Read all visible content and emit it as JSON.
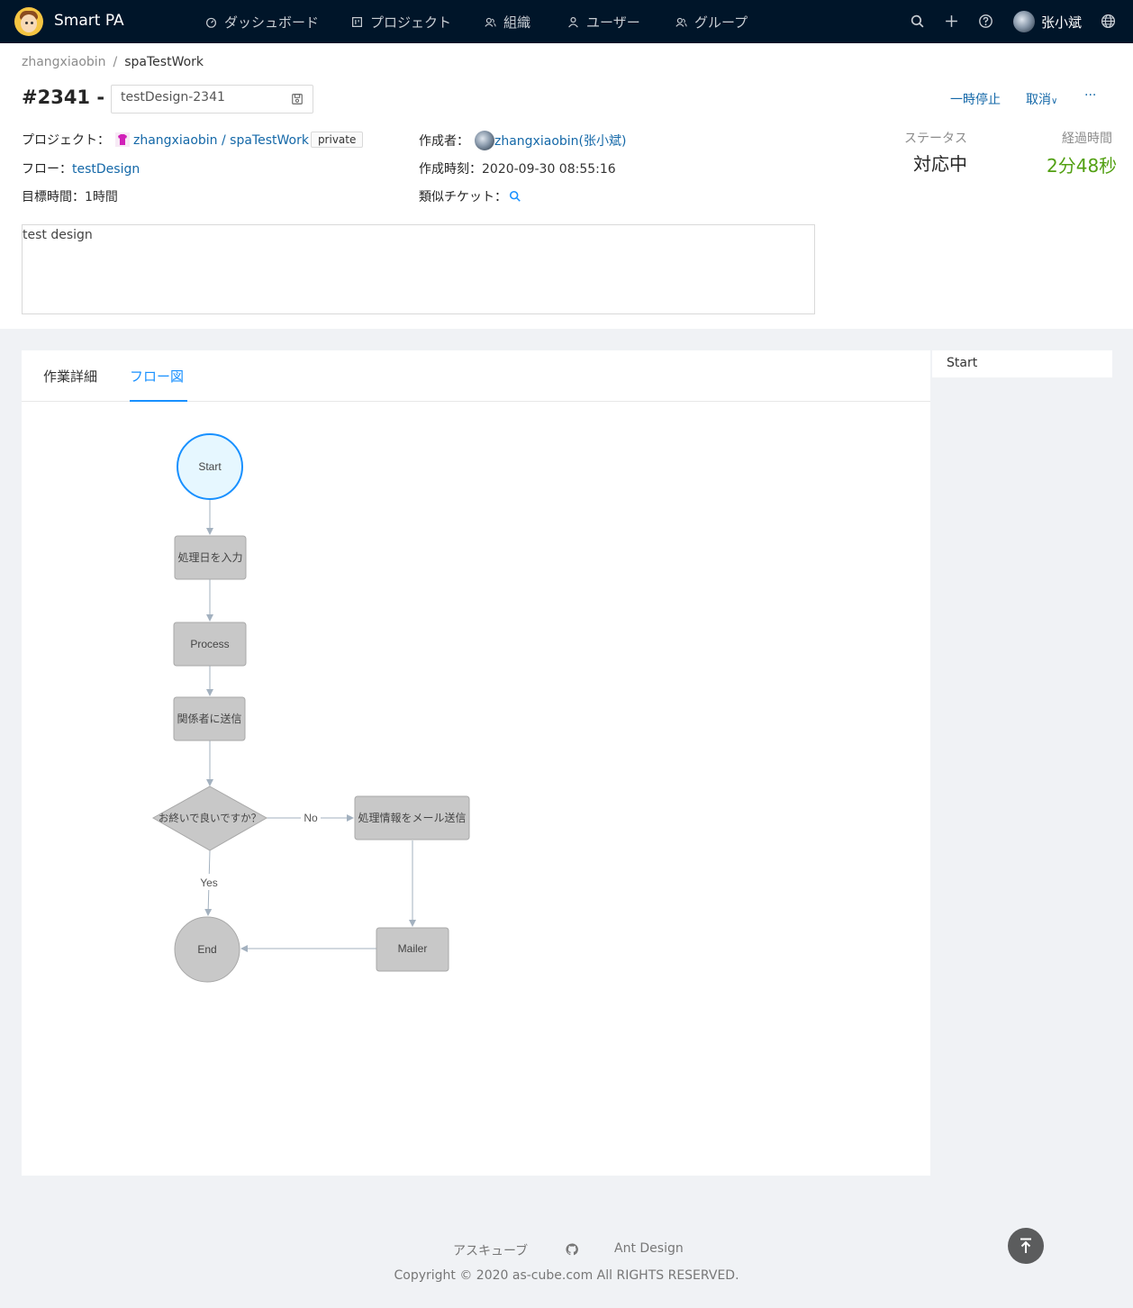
{
  "header": {
    "brand": "Smart PA",
    "nav": [
      {
        "label": "ダッシュボード",
        "icon": "dashboard-icon"
      },
      {
        "label": "プロジェクト",
        "icon": "project-icon"
      },
      {
        "label": "組織",
        "icon": "team-icon"
      },
      {
        "label": "ユーザー",
        "icon": "user-icon"
      },
      {
        "label": "グループ",
        "icon": "team-icon"
      }
    ],
    "user_name": "张小斌",
    "icons": [
      "search-icon",
      "plus-icon",
      "question-icon",
      "global-icon"
    ]
  },
  "breadcrumb": {
    "owner": "zhangxiaobin",
    "separator": "/",
    "project": "spaTestWork"
  },
  "ticket": {
    "number": "#2341 -",
    "title_value": "testDesign-2341",
    "actions": {
      "pause": "一時停止",
      "cancel": "取消",
      "cancel_chevron": "∨",
      "more": "···"
    }
  },
  "fields": {
    "project_label": "プロジェクト：",
    "project_value": "zhangxiaobin / spaTestWork",
    "project_visibility": "private",
    "flow_label": "フロー：",
    "flow_value": "testDesign",
    "target_label": "目標時間：",
    "target_value": "1時間",
    "author_label": "作成者：",
    "author_value": "zhangxiaobin(张小斌)",
    "created_label": "作成時刻：",
    "created_value": "2020-09-30 08:55:16",
    "similar_label": "類似チケット："
  },
  "status": {
    "status_label": "ステータス",
    "status_value": "対応中",
    "elapsed_label": "経過時間",
    "elapsed_value": "2分48秒",
    "elapsed_color": "#52a012"
  },
  "description": "test design",
  "tabs": [
    {
      "label": "作業詳細",
      "active": false
    },
    {
      "label": "フロー図",
      "active": true
    }
  ],
  "flow": {
    "nodes": {
      "start": "Start",
      "input_date": "処理日を入力",
      "process": "Process",
      "notify": "関係者に送信",
      "decision": "お終いで良いですか？",
      "mail_info": "処理情報をメール送信",
      "mailer": "Mailer",
      "end": "End"
    },
    "edge_labels": {
      "no": "No",
      "yes": "Yes"
    },
    "colors": {
      "start_fill": "#e6f7ff",
      "start_stroke": "#1890ff",
      "node_fill": "#c8c8c8",
      "node_stroke": "#a8a8a8",
      "edge": "#a3b1bf"
    }
  },
  "side_panel": {
    "selected": "Start"
  },
  "footer": {
    "link1": "アスキューブ",
    "github_icon": "github-icon",
    "link2": "Ant Design",
    "copyright": "Copyright © 2020 as-cube.com All RIGHTS RESERVED."
  }
}
